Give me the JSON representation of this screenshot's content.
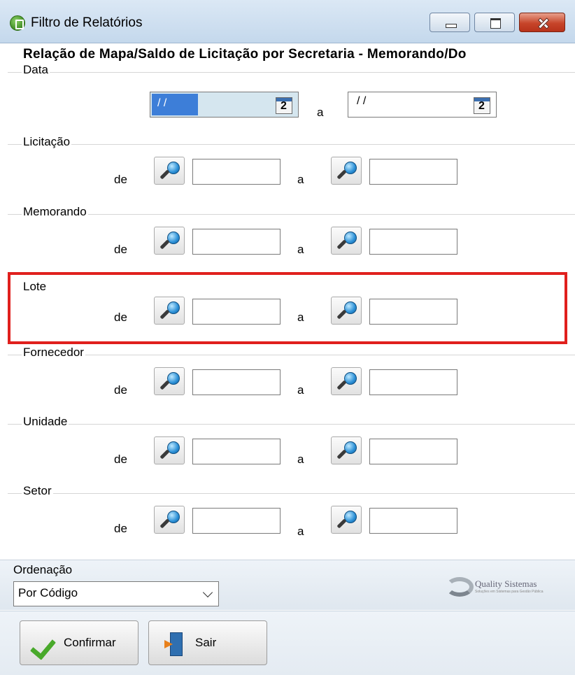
{
  "window": {
    "title": "Filtro de Relatórios",
    "icons": {
      "app": "report-icon",
      "minimize": "minimize-icon",
      "maximize": "maximize-icon",
      "close": "close-icon"
    }
  },
  "heading": "Relação de Mapa/Saldo de Licitação por Secretaria - Memorando/Do",
  "date_group": {
    "label": "Data",
    "from_value": "/ /",
    "to_label": "a",
    "to_value": "/ /",
    "calendar_icon_text": "2"
  },
  "range_groups": [
    {
      "label": "Licitação",
      "from_label": "de",
      "to_label": "a",
      "from_value": "",
      "to_value": ""
    },
    {
      "label": "Memorando",
      "from_label": "de",
      "to_label": "a",
      "from_value": "",
      "to_value": ""
    },
    {
      "label": "Lote",
      "from_label": "de",
      "to_label": "a",
      "from_value": "",
      "to_value": ""
    },
    {
      "label": "Fornecedor",
      "from_label": "de",
      "to_label": "a",
      "from_value": "",
      "to_value": ""
    },
    {
      "label": "Unidade",
      "from_label": "de",
      "to_label": "a",
      "from_value": "",
      "to_value": ""
    },
    {
      "label": "Setor",
      "from_label": "de",
      "to_label": "a",
      "from_value": "",
      "to_value": ""
    }
  ],
  "ordering": {
    "label": "Ordenação",
    "selected": "Por Código"
  },
  "logo": {
    "name": "Quality Sistemas",
    "tagline": "Soluções em Sistemas para Gestão Pública"
  },
  "buttons": {
    "confirm": "Confirmar",
    "exit": "Sair"
  },
  "highlight_color": "#e0201d"
}
